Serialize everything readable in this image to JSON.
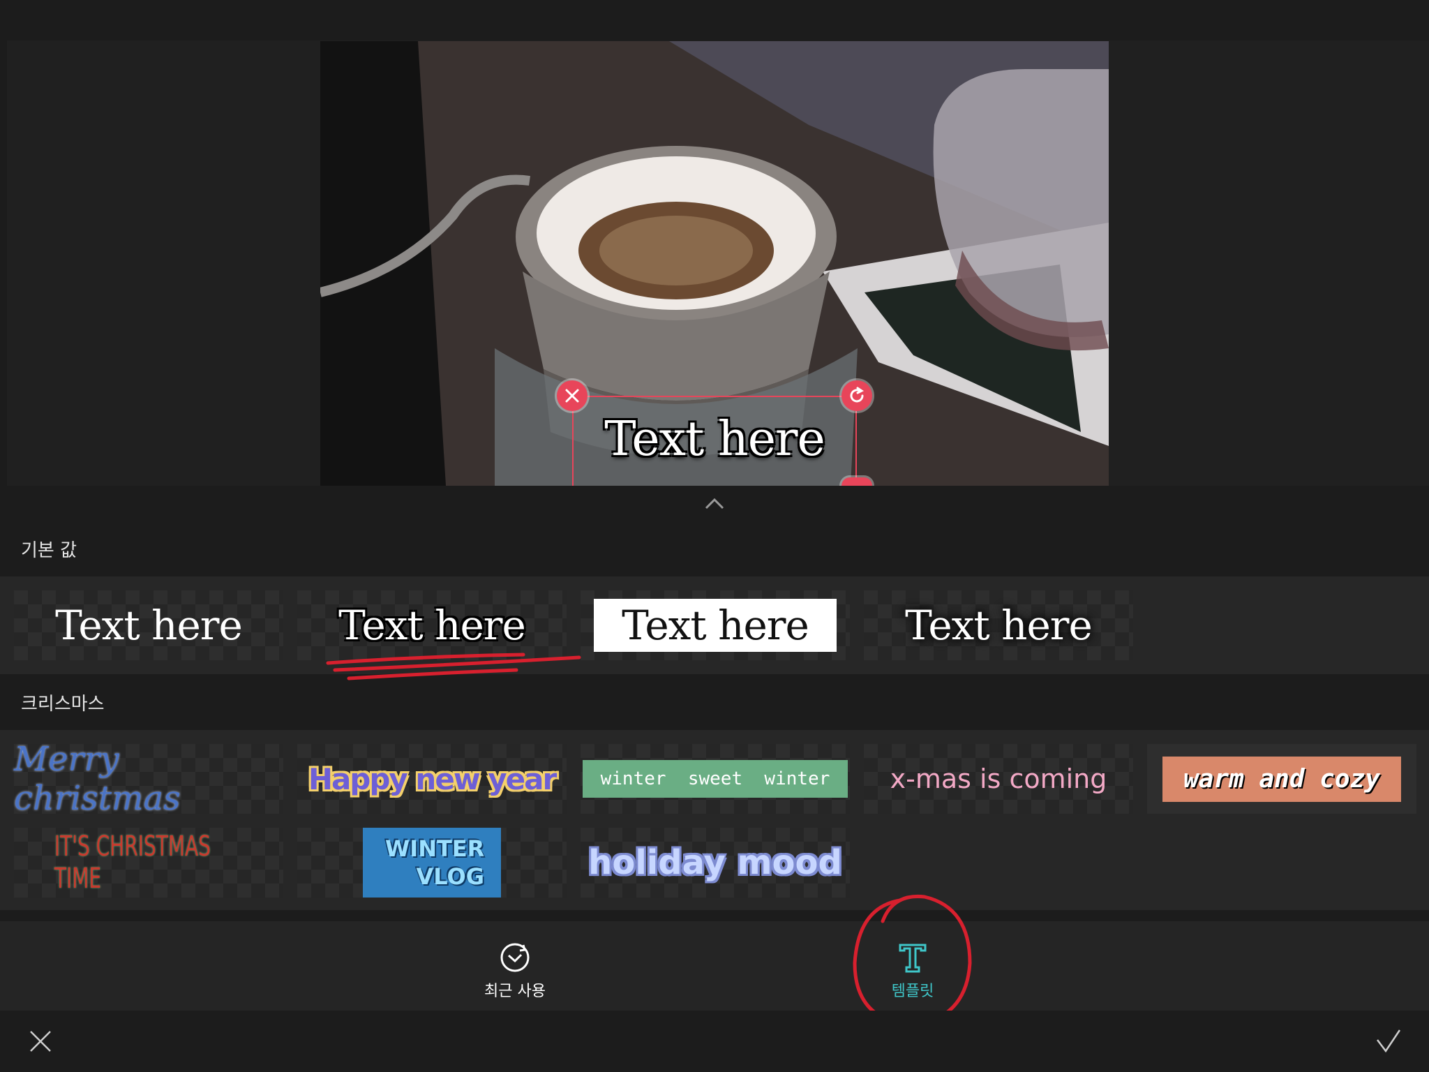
{
  "preview": {
    "overlay_text": "Text here"
  },
  "sections": {
    "basic": {
      "title": "기본 값",
      "tiles": [
        "Text here",
        "Text here",
        "Text here",
        "Text here"
      ]
    },
    "christmas": {
      "title": "크리스마스",
      "tiles": [
        "Merry christmas",
        "Happy new year",
        "winter  sweet  winter",
        "x-mas is coming",
        "warm and cozy",
        "IT'S CHRISTMAS TIME",
        "WINTER",
        "VLOG",
        "holiday mood"
      ]
    }
  },
  "tabs": {
    "recent": "최근 사용",
    "template": "템플릿"
  },
  "colors": {
    "accent": "#e8455a",
    "active_tab": "#3fc6c9",
    "background": "#1c1c1c"
  },
  "icons": {
    "recent": "clock-history-icon",
    "template": "text-template-icon",
    "cancel": "close-icon",
    "confirm": "check-icon",
    "collapse": "chevron-up-icon"
  }
}
